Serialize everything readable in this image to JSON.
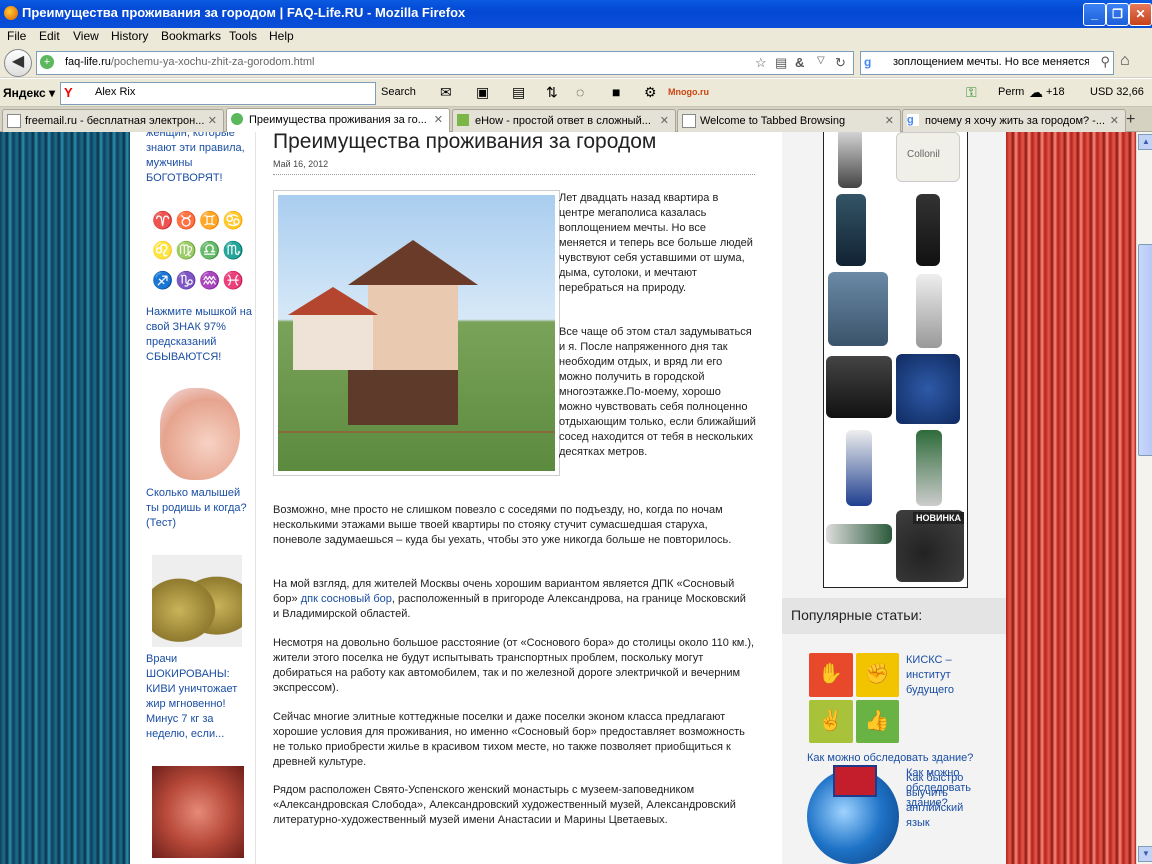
{
  "window": {
    "title": "Преимущества проживания за городом | FAQ-Life.RU - Mozilla Firefox",
    "minimize": "_",
    "maximize": "❐",
    "close": "✕"
  },
  "menu": [
    "File",
    "Edit",
    "View",
    "History",
    "Bookmarks",
    "Tools",
    "Help"
  ],
  "nav": {
    "url_domain": "faq-life.ru",
    "url_path": "/pochemu-ya-xochu-zhit-za-gorodom.html",
    "search_value": "зоплощением мечты. Но все меняется"
  },
  "yandex": {
    "logo": "Яндекс",
    "search_value": "Alex Rix",
    "search_button": "Search",
    "mnogo": "Mnogo.ru",
    "city": "Perm",
    "temperature": "+18",
    "usd": "USD 32,66"
  },
  "tabs": [
    {
      "label": "freemail.ru - бесплатная электрон...",
      "active": false
    },
    {
      "label": "Преимущества проживания за го...",
      "active": true
    },
    {
      "label": "eHow - простой ответ в сложный...",
      "active": false
    },
    {
      "label": "Welcome to Tabbed Browsing",
      "active": false
    },
    {
      "label": "почему я хочу жить за городом? -...",
      "active": false
    }
  ],
  "left_sidebar": {
    "link1": "женщин, которые знают эти правила, мужчины БОГОТВОРЯТ!",
    "link2": "Нажмите мышкой на свой ЗНАК 97% предсказаний СБЫВАЮТСЯ!",
    "link3": "Сколько малышей ты родишь и когда? (Тест)",
    "link4": "Врачи ШОКИРОВАНЫ: КИВИ уничтожает жир мгновенно! Минус 7 кг за неделю, если..."
  },
  "article": {
    "title": "Преимущества проживания за городом",
    "date": "Май 16, 2012",
    "p1": "Лет двадцать назад квартира в центре мегаполиса казалась воплощением мечты. Но все меняется и теперь все больше людей чувствуют себя уставшими от шума, дыма, сутолоки, и мечтают перебраться на природу.",
    "p2": "Все чаще об этом стал задумываться и я. После напряженного дня так необходим отдых, и вряд ли его можно получить в городской многоэтажке.По-моему, хорошо можно чувствовать себя полноценно отдыхающим только, если ближайший сосед находится от тебя в нескольких десятках метров.",
    "p3": "Возможно, мне просто не слишком повезло с соседями по подъезду, но, когда по ночам несколькими этажами выше твоей квартиры по стояку стучит сумасшедшая старуха, поневоле задумаешься – куда бы уехать, чтобы это уже никогда больше не повторилось.",
    "p4_before": "На мой взгляд, для жителей Москвы очень хорошим вариантом является ДПК «Сосновый бор» ",
    "p4_link": "дпк сосновый бор",
    "p4_after": ", расположенный в пригороде Александрова, на границе Московский и Владимирской областей.",
    "p5": "Несмотря на довольно большое расстояние (от «Соснового бора» до столицы около 110 км.), жители этого поселка не будут испытывать транспортных проблем, поскольку могут добираться на работу как автомобилем, так и по железной дороге электричкой и вечерним экспрессом).",
    "p6": "Сейчас многие элитные коттеджные поселки и даже поселки эконом класса предлагают хорошие условия для проживания, но именно «Сосновый бор» предоставляет возможность не только приобрести жилье в красивом тихом месте, но также позволяет приобщиться к древней культуре.",
    "p7": "Рядом расположен Свято-Успенского женский монастырь с музеем-заповедником «Александровская Слобода», Александровский художественный музей, Александровский литературно-художественный музей имени Анастасии и Марины Цветаевых."
  },
  "right_sidebar": {
    "ad_badge": "НОВИНКА",
    "ad_brand": "Collonil",
    "popular_heading": "Популярные статьи:",
    "pop1": "КИСКС – институт будущего",
    "pop2": "Как можно обследовать здание?",
    "pop3": "Как быстро выучить английский язык"
  }
}
